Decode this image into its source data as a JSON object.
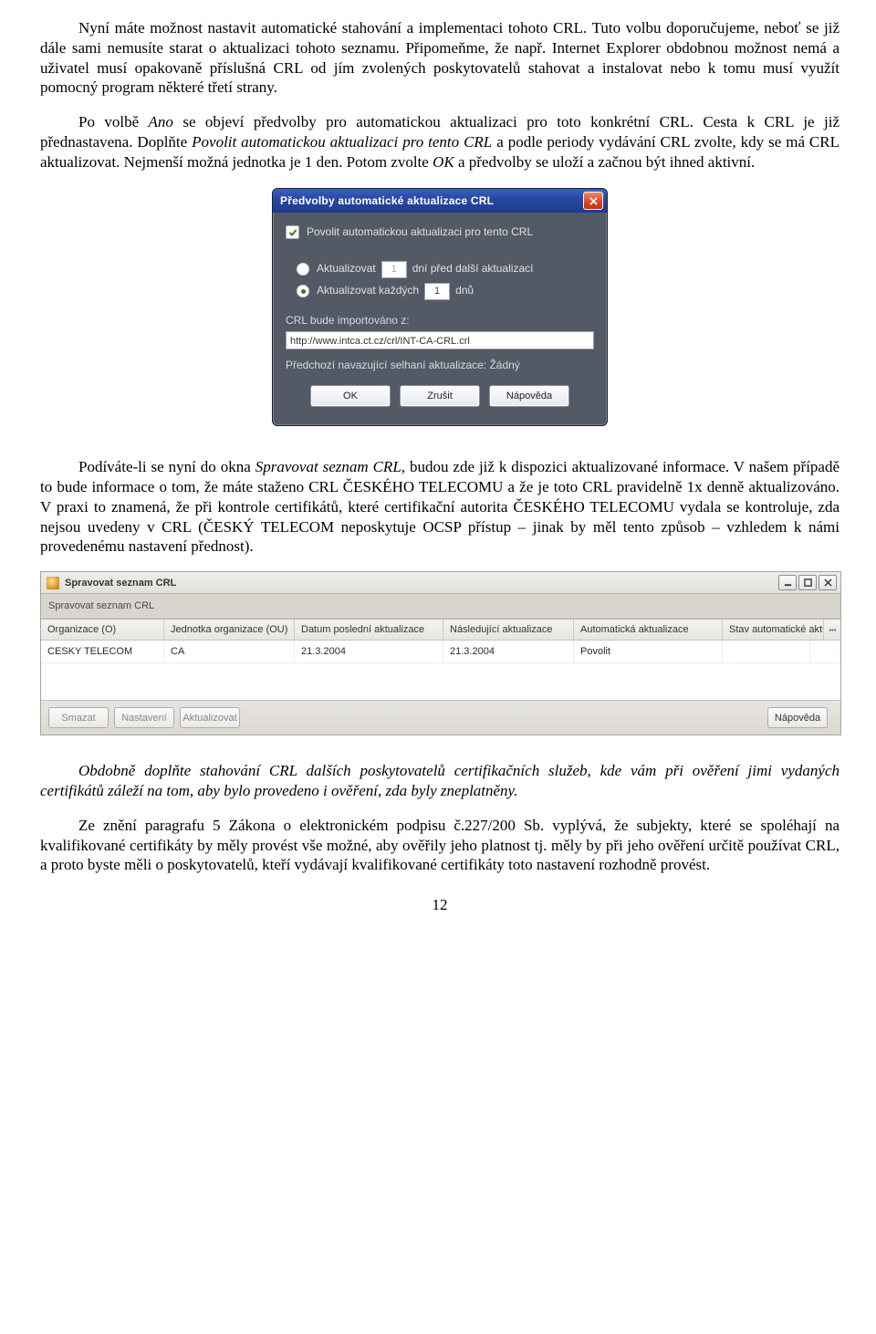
{
  "para1_a": "Nyní máte možnost nastavit automatické stahování a implementaci tohoto CRL. Tuto volbu doporučujeme, neboť se již dále sami nemusíte starat o aktualizaci tohoto seznamu. Připomeňme, že např. Internet Explorer obdobnou možnost nemá a uživatel musí opakovaně příslušná CRL od jím zvolených poskytovatelů stahovat a instalovat nebo k tomu musí využít pomocný program některé třetí strany.",
  "para2_a": "Po volbě ",
  "para2_b": "Ano",
  "para2_c": " se objeví předvolby pro automatickou aktualizaci pro toto konkrétní CRL. Cesta k CRL je již přednastavena. Doplňte ",
  "para2_d": "Povolit automatickou aktualizaci pro tento CRL",
  "para2_e": " a podle periody vydávání CRL zvolte, kdy se má CRL aktualizovat. Nejmenší možná jednotka je 1 den. Potom zvolte ",
  "para2_f": "OK",
  "para2_g": " a předvolby se uloží a začnou být ihned aktivní.",
  "dialog": {
    "title": "Předvolby automatické aktualizace CRL",
    "enable_label": "Povolit automatickou aktualizaci pro tento CRL",
    "radio1_a": "Aktualizovat",
    "radio1_val": "1",
    "radio1_b": "dní před další aktualizací",
    "radio2_a": "Aktualizovat každých",
    "radio2_val": "1",
    "radio2_b": "dnů",
    "import_label": "CRL bude importováno z:",
    "url": "http://www.intca.ct.cz/crl/INT-CA-CRL.crl",
    "fail_label": "Předchozí navazující selhaní aktualizace: Žádný",
    "ok": "OK",
    "cancel": "Zrušit",
    "help": "Nápověda"
  },
  "para3_a": "Podíváte-li se nyní do okna ",
  "para3_b": "Spravovat seznam CRL,",
  "para3_c": " budou zde již k dispozici aktualizované informace. V našem případě to bude informace o tom, že máte staženo CRL ČESKÉHO TELECOMU a že je toto CRL pravidelně 1x denně aktualizováno. V praxi to znamená, že při kontrole certifikátů, které certifikační autorita ČESKÉHO TELECOMU vydala se kontroluje, zda nejsou uvedeny v CRL (ČESKÝ TELECOM neposkytuje OCSP přístup – jinak by měl tento způsob – vzhledem k námi provedenému nastavení přednost).",
  "crlwin": {
    "title": "Spravovat seznam CRL",
    "subtitle": "Spravovat seznam CRL",
    "cols": [
      "Organizace (O)",
      "Jednotka organizace (OU)",
      "Datum poslední aktualizace",
      "Následující aktualizace",
      "Automatická aktualizace",
      "Stav automatické aktualizace"
    ],
    "row": [
      "CESKY TELECOM",
      "CA",
      "21.3.2004",
      "21.3.2004",
      "Povolit",
      ""
    ],
    "btn_delete": "Smazat",
    "btn_settings": "Nastavení",
    "btn_update": "Aktualizovat",
    "btn_help": "Nápověda"
  },
  "para4_a": "Obdobně doplňte stahování CRL dalších poskytovatelů certifikačních služeb, kde vám při ověření jimi vydaných certifikátů záleží na tom, aby bylo provedeno i ověření, zda byly zneplatněny.",
  "para5_a": "Ze znění paragrafu 5 Zákona o elektronickém podpisu č.227/200 Sb. vyplývá, že subjekty, které se spoléhají na kvalifikované certifikáty by měly provést vše možné, aby ověřily jeho platnost tj. měly by při jeho ověření určitě používat CRL, a proto byste měli o poskytovatelů, kteří vydávají kvalifikované certifikáty toto nastavení rozhodně provést.",
  "page_no": "12"
}
